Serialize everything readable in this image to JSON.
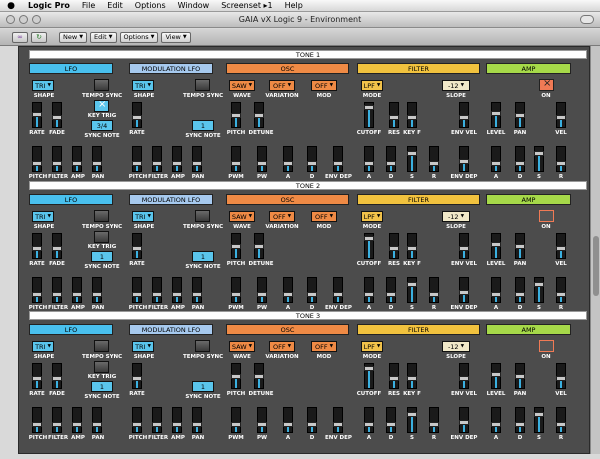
{
  "menubar": {
    "app": "Logic Pro",
    "items": [
      "File",
      "Edit",
      "Options",
      "Window",
      "Screenset ▸1",
      "Help"
    ]
  },
  "window": {
    "title": "GAIA vX Logic 9 - Environment"
  },
  "toolbar": {
    "buttons": [
      "New",
      "Edit",
      "Options",
      "View"
    ]
  },
  "labels": {
    "shape": "SHAPE",
    "tempo_sync": "TEMPO SYNC",
    "rate": "RATE",
    "fade": "FADE",
    "key_trig": "KEY TRIG",
    "sync_note": "SYNC NOTE",
    "pitch": "PITCH",
    "filter": "FILTER",
    "amp": "AMP",
    "pan": "PAN",
    "wave": "WAVE",
    "variation": "VARIATION",
    "mod": "MOD",
    "detune": "DETUNE",
    "pwm": "PWM",
    "pw": "PW",
    "a": "A",
    "d": "D",
    "s": "S",
    "r": "R",
    "env_dep": "ENV DEP",
    "mode": "MODE",
    "slope": "SLOPE",
    "cutoff": "CUTOFF",
    "res": "RES",
    "key_f": "KEY F",
    "env_vel": "ENV VEL",
    "level": "LEVEL",
    "vel": "VEL",
    "on": "ON"
  },
  "tones": [
    {
      "title": "TONE 1",
      "sections": {
        "lfo": "LFO",
        "mlfo": "MODULATION LFO",
        "osc": "OSC",
        "filter": "FILTER",
        "amp": "AMP"
      },
      "lfo_shape": "TRI",
      "mlfo_shape": "TRI",
      "lfo_sync_note": "3/4",
      "mlfo_sync_note": "1",
      "wave": "SAW",
      "variation": "OFF",
      "mod": "OFF",
      "filter_mode": "LPF",
      "slope": "-12",
      "levels": {
        "lfo_rate": 0.55,
        "lfo_fade": 0.4,
        "lfo_pitch": 0.3,
        "lfo_filter": 0.3,
        "lfo_amp": 0.3,
        "lfo_pan": 0.3,
        "mlfo_rate": 0.4,
        "mlfo_pitch": 0.3,
        "mlfo_filter": 0.3,
        "mlfo_amp": 0.3,
        "mlfo_pan": 0.3,
        "osc_pitch": 0.5,
        "osc_detune": 0.5,
        "osc_pwm": 0.3,
        "osc_pw": 0.3,
        "osc_a": 0.3,
        "osc_d": 0.3,
        "osc_env_dep": 0.3,
        "flt_cutoff": 0.9,
        "flt_res": 0.4,
        "flt_key_f": 0.4,
        "flt_env_vel": 0.4,
        "flt_a": 0.3,
        "flt_d": 0.3,
        "flt_s": 0.8,
        "flt_r": 0.3,
        "flt_env_dep": 0.4,
        "amp_level": 0.6,
        "amp_pan": 0.5,
        "amp_vel": 0.4,
        "amp_a": 0.3,
        "amp_d": 0.3,
        "amp_s": 0.8,
        "amp_r": 0.3
      }
    },
    {
      "title": "TONE 2",
      "sections": {
        "lfo": "LFO",
        "mlfo": "MODULATION LFO",
        "osc": "OSC",
        "filter": "FILTER",
        "amp": "AMP"
      },
      "lfo_shape": "TRI",
      "mlfo_shape": "TRI",
      "lfo_sync_note": "1",
      "mlfo_sync_note": "1",
      "wave": "SAW",
      "variation": "OFF",
      "mod": "OFF",
      "filter_mode": "LPF",
      "slope": "-12",
      "levels": {
        "lfo_rate": 0.4,
        "lfo_fade": 0.4,
        "lfo_pitch": 0.3,
        "lfo_filter": 0.3,
        "lfo_amp": 0.3,
        "lfo_pan": 0.3,
        "mlfo_rate": 0.4,
        "mlfo_pitch": 0.3,
        "mlfo_filter": 0.3,
        "mlfo_amp": 0.3,
        "mlfo_pan": 0.3,
        "osc_pitch": 0.5,
        "osc_detune": 0.5,
        "osc_pwm": 0.3,
        "osc_pw": 0.3,
        "osc_a": 0.3,
        "osc_d": 0.3,
        "osc_env_dep": 0.3,
        "flt_cutoff": 0.9,
        "flt_res": 0.4,
        "flt_key_f": 0.4,
        "flt_env_vel": 0.4,
        "flt_a": 0.3,
        "flt_d": 0.3,
        "flt_s": 0.8,
        "flt_r": 0.3,
        "flt_env_dep": 0.4,
        "amp_level": 0.6,
        "amp_pan": 0.5,
        "amp_vel": 0.4,
        "amp_a": 0.3,
        "amp_d": 0.3,
        "amp_s": 0.8,
        "amp_r": 0.3
      }
    },
    {
      "title": "TONE 3",
      "sections": {
        "lfo": "LFO",
        "mlfo": "MODULATION LFO",
        "osc": "OSC",
        "filter": "FILTER",
        "amp": "AMP"
      },
      "lfo_shape": "TRI",
      "mlfo_shape": "TRI",
      "lfo_sync_note": "1",
      "mlfo_sync_note": "1",
      "wave": "SAW",
      "variation": "OFF",
      "mod": "OFF",
      "filter_mode": "LPF",
      "slope": "-12",
      "levels": {
        "lfo_rate": 0.4,
        "lfo_fade": 0.4,
        "lfo_pitch": 0.3,
        "lfo_filter": 0.3,
        "lfo_amp": 0.3,
        "lfo_pan": 0.3,
        "mlfo_rate": 0.4,
        "mlfo_pitch": 0.3,
        "mlfo_filter": 0.3,
        "mlfo_amp": 0.3,
        "mlfo_pan": 0.3,
        "osc_pitch": 0.5,
        "osc_detune": 0.5,
        "osc_pwm": 0.3,
        "osc_pw": 0.3,
        "osc_a": 0.3,
        "osc_d": 0.3,
        "osc_env_dep": 0.3,
        "flt_cutoff": 0.9,
        "flt_res": 0.4,
        "flt_key_f": 0.4,
        "flt_env_vel": 0.4,
        "flt_a": 0.3,
        "flt_d": 0.3,
        "flt_s": 0.8,
        "flt_r": 0.3,
        "flt_env_dep": 0.4,
        "amp_level": 0.6,
        "amp_pan": 0.5,
        "amp_vel": 0.4,
        "amp_a": 0.3,
        "amp_d": 0.3,
        "amp_s": 0.8,
        "amp_r": 0.3
      }
    }
  ]
}
